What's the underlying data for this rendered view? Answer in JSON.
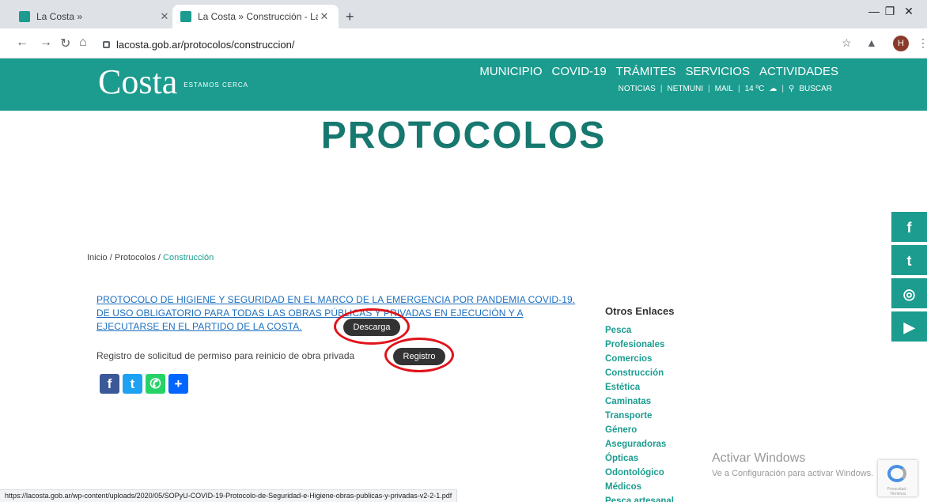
{
  "browser": {
    "tabs": [
      {
        "title": "La Costa »",
        "active": false
      },
      {
        "title": "La Costa » Construcción - La Cos",
        "active": true
      }
    ],
    "new_tab": "+",
    "url": "lacosta.gob.ar/protocolos/construccion/",
    "profile_initial": "H",
    "status_url": "https://lacosta.gob.ar/wp-content/uploads/2020/05/SOPyU-COVID-19-Protocolo-de-Seguridad-e-Higiene-obras-publicas-y-privadas-v2-2-1.pdf"
  },
  "site": {
    "logo_main": "Costa",
    "logo_small": "La",
    "logo_tag": "ESTAMOS CERCA",
    "main_nav": [
      "MUNICIPIO",
      "COVID-19",
      "TRÁMITES",
      "SERVICIOS",
      "ACTIVIDADES"
    ],
    "sub_nav": [
      "NOTICIAS",
      "NETMUNI",
      "MAIL",
      "14 ºC",
      "BUSCAR"
    ],
    "brand_color": "#1b9c8f"
  },
  "page": {
    "title": "PROTOCOLOS",
    "breadcrumb": {
      "home": "Inicio",
      "parent": "Protocolos",
      "current": "Construcción",
      "sep": " / "
    },
    "protocol_link": "PROTOCOLO DE HIGIENE Y SEGURIDAD EN EL MARCO DE LA EMERGENCIA POR PANDEMIA COVID-19. DE USO OBLIGATORIO PARA TODAS LAS OBRAS PÚBLICAS Y PRIVADAS EN EJECUCIÓN Y A EJECUTARSE EN EL PARTIDO DE LA COSTA.",
    "download_label": "Descarga",
    "registro_text": "Registro de solicitud de permiso para reinicio de obra privada",
    "registro_label": "Registro"
  },
  "sidebar": {
    "title": "Otros Enlaces",
    "links": [
      "Pesca",
      "Profesionales",
      "Comercios",
      "Construcción",
      "Estética",
      "Caminatas",
      "Transporte",
      "Género",
      "Aseguradoras",
      "Ópticas",
      "Odontológico",
      "Médicos",
      "Pesca artesanal"
    ]
  },
  "social": [
    "facebook-icon",
    "twitter-icon",
    "instagram-icon",
    "youtube-icon"
  ],
  "windows_watermark": {
    "line1": "Activar Windows",
    "line2": "Ve a Configuración para activar Windows."
  },
  "recaptcha_text": "Privacidad - Términos"
}
